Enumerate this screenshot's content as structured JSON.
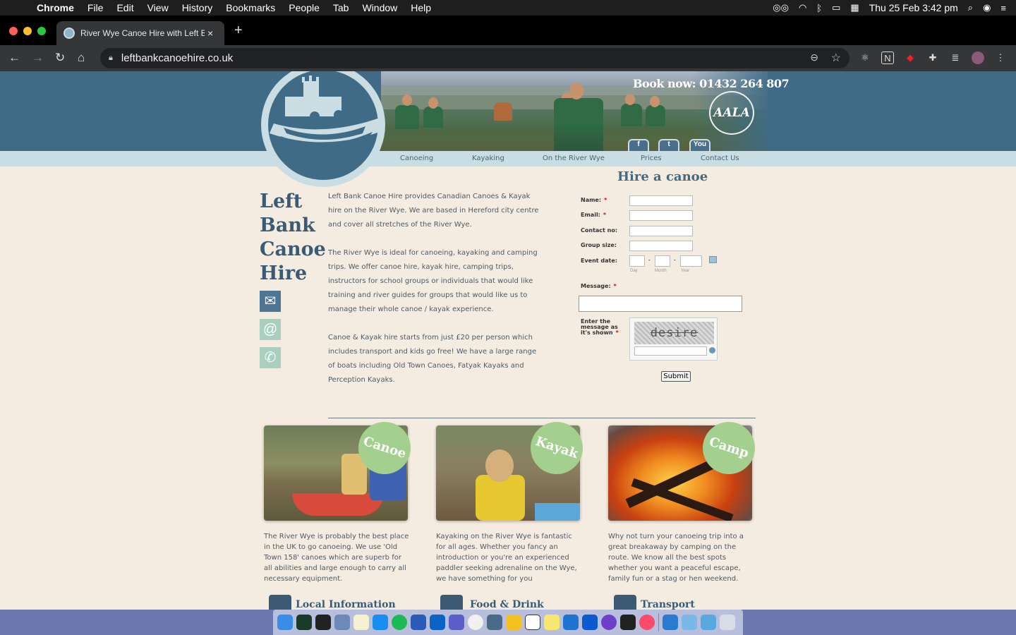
{
  "menubar": {
    "app": "Chrome",
    "items": [
      "File",
      "Edit",
      "View",
      "History",
      "Bookmarks",
      "People",
      "Tab",
      "Window",
      "Help"
    ],
    "clock": "Thu 25 Feb  3:42 pm"
  },
  "browser": {
    "tab_title": "River Wye Canoe Hire with Left Bank",
    "tab_close": "×",
    "new_tab": "+",
    "url": "leftbankcanoehire.co.uk"
  },
  "header": {
    "book_now": "Book now: 01432 264 807",
    "aala": "AALA",
    "social": [
      "f",
      "t",
      "You"
    ]
  },
  "nav": {
    "items": [
      "Canoeing",
      "Kayaking",
      "On the River Wye",
      "Prices",
      "Contact Us"
    ]
  },
  "sidebar": {
    "title_lines": [
      "Left",
      "Bank",
      "Canoe",
      "Hire"
    ]
  },
  "intro": {
    "p1": "Left Bank Canoe Hire provides Canadian Canoes & Kayak hire on the River Wye. We are based in Hereford city centre and cover all stretches of the River Wye.",
    "p2": "The River Wye is ideal for canoeing, kayaking and camping trips. We offer canoe hire, kayak hire, camping trips, instructors for school groups or individuals that would like training and river guides for groups that would like us to manage their whole canoe / kayak experience.",
    "p3": "Canoe & Kayak hire starts from just £20 per person which includes transport and kids go free! We have a large range of boats including Old Town Canoes, Fatyak Kayaks and Perception Kayaks."
  },
  "form": {
    "title": "Hire a canoe",
    "name_label": "Name:",
    "email_label": "Email:",
    "contact_label": "Contact no:",
    "group_label": "Group size:",
    "date_label": "Event date:",
    "day": "Day",
    "month": "Month",
    "year": "Year",
    "message_label": "Message:",
    "captcha_label": "Enter the message as it's shown",
    "captcha_text": "desire",
    "required_mark": "*",
    "date_sep": "-",
    "submit": "Submit"
  },
  "cards": [
    {
      "badge": "Canoe",
      "text": "The River Wye is probably the best place in the UK to go canoeing. We use 'Old Town 158' canoes which are superb for all abilities and large enough to carry all necessary equipment."
    },
    {
      "badge": "Kayak",
      "text": "Kayaking on the River Wye is fantastic for all ages. Whether you fancy an introduction or you're an experienced paddler seeking adrenaline on the Wye, we have something for you"
    },
    {
      "badge": "Camp",
      "text": "Why not turn your canoeing trip into a great breakaway by camping on the route. We know all the best spots whether you want a peaceful escape, family fun or a stag or hen weekend."
    }
  ],
  "sections": [
    "Local Information",
    "Food & Drink",
    "Transport"
  ],
  "colors": {
    "header_blue": "#3f6b87",
    "page_bg": "#f5ece1",
    "badge_green": "#a3cf8f"
  }
}
